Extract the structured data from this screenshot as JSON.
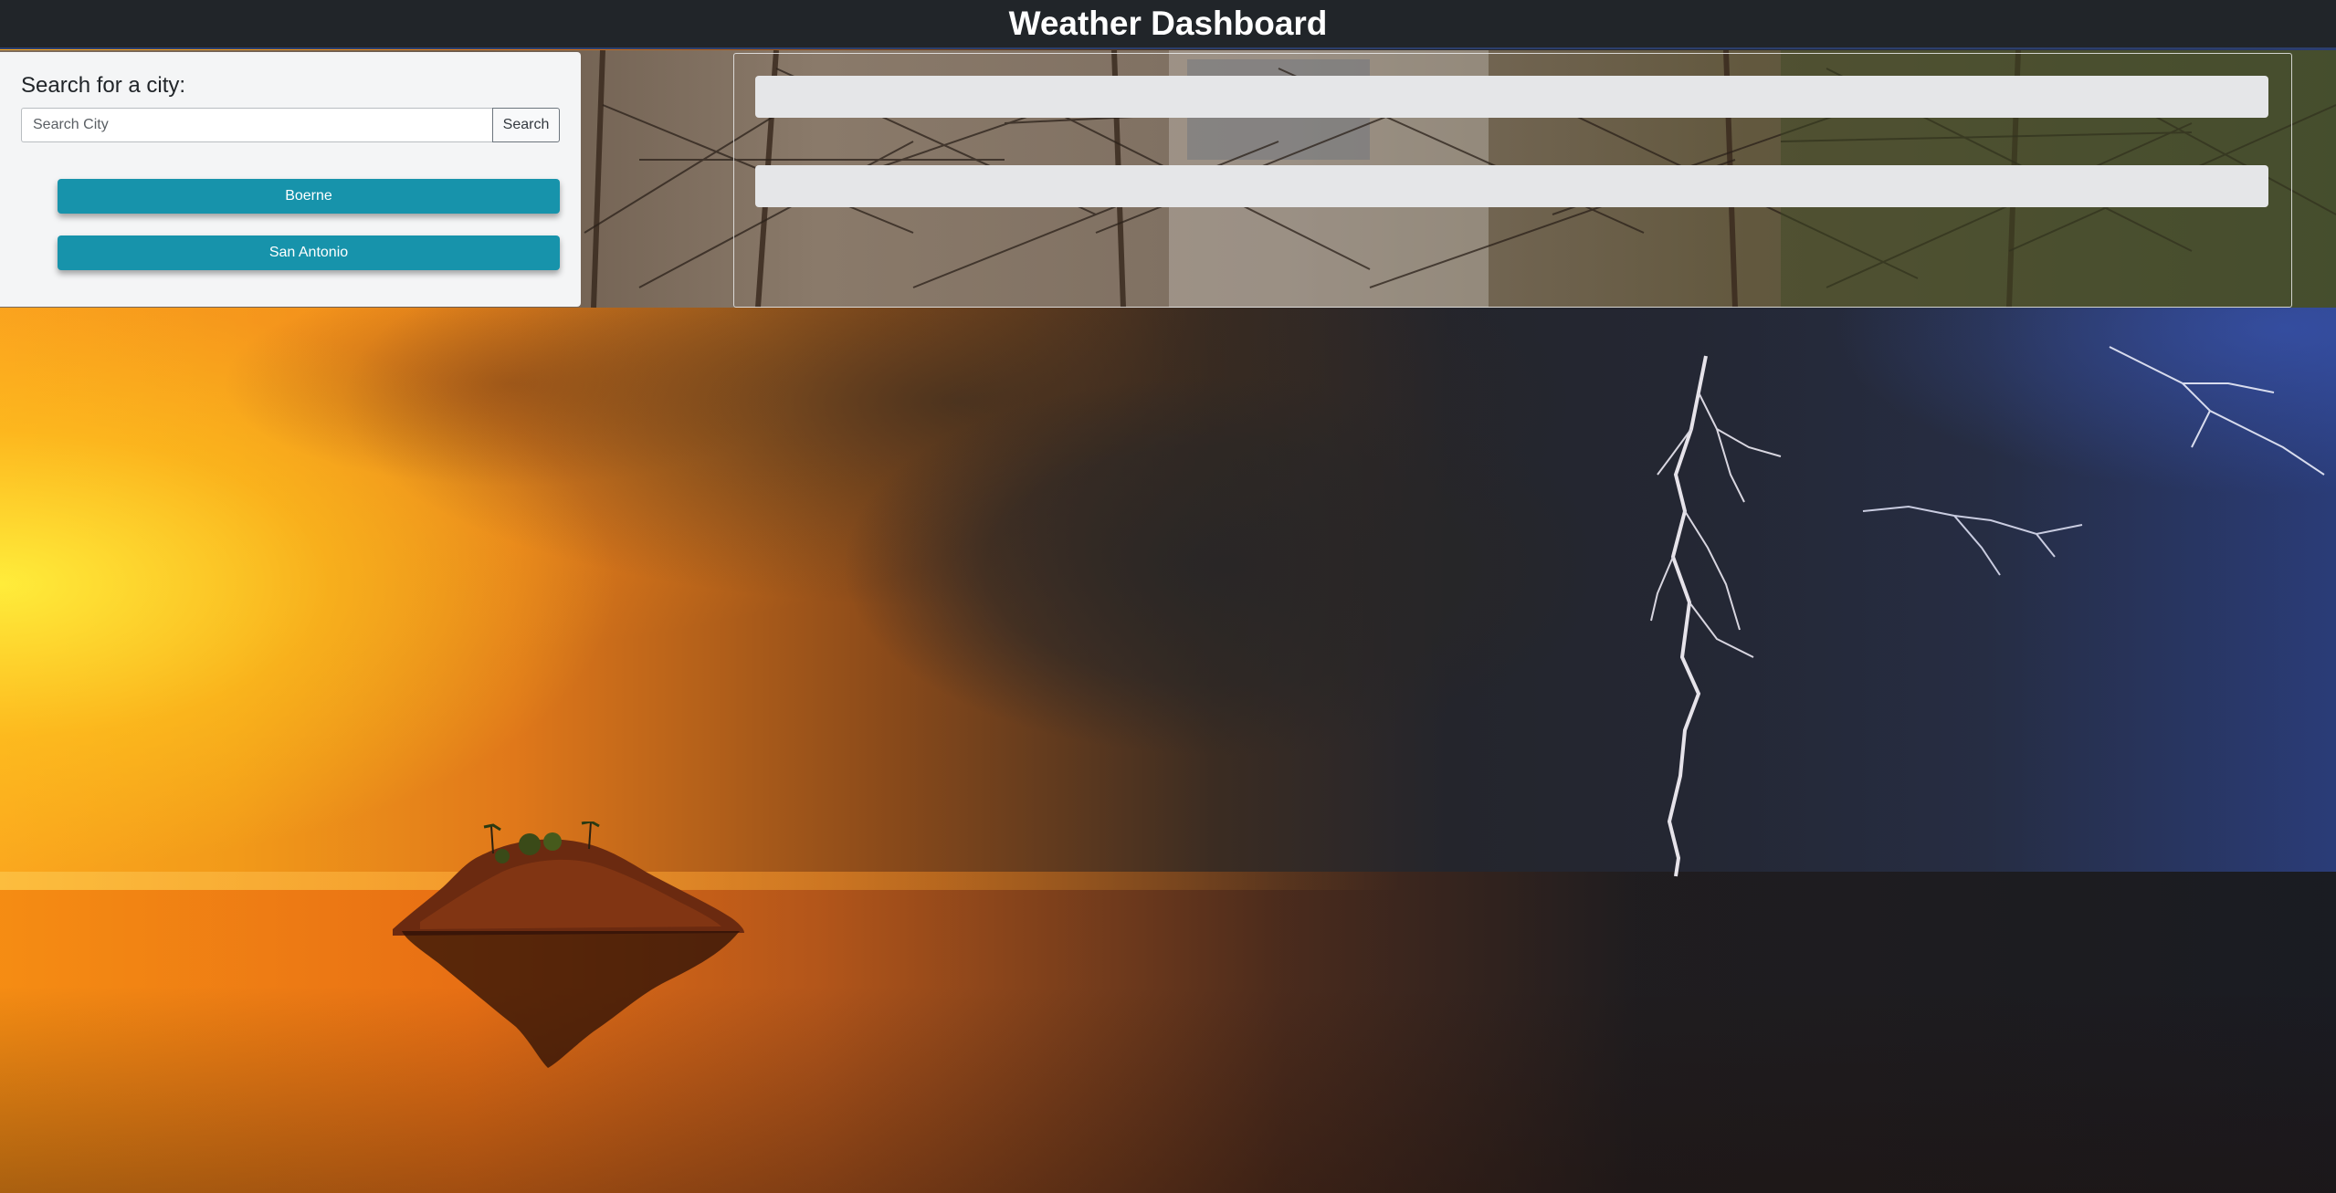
{
  "header": {
    "title": "Weather Dashboard"
  },
  "search": {
    "heading": "Search for a city:",
    "placeholder": "Search City",
    "value": "",
    "button_label": "Search"
  },
  "history": {
    "cities": [
      "Boerne",
      "San Antonio"
    ]
  },
  "results": {
    "current_weather": "",
    "forecast": ""
  },
  "colors": {
    "navbar": "#212529",
    "city_button": "#1793ab",
    "panel_bg": "#f4f5f6",
    "result_bar": "#e5e6e8"
  }
}
